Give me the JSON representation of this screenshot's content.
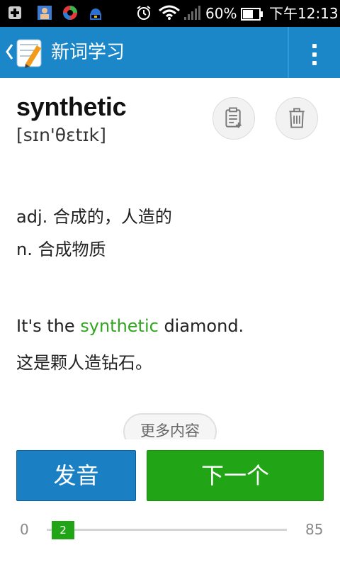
{
  "status_bar": {
    "battery_percent": "60%",
    "time": "下午12:13",
    "icons": [
      "add-icon",
      "contacts-app-icon",
      "colorful-app-icon",
      "android-download-icon",
      "alarm-icon",
      "wifi-icon",
      "signal-icon",
      "battery-icon"
    ]
  },
  "action_bar": {
    "title": "新词学习",
    "icons": [
      "back-chevron-icon",
      "app-logo-icon",
      "overflow-menu-icon"
    ]
  },
  "word": {
    "text": "synthetic",
    "phonetic": "[sɪn'θɛtɪk]"
  },
  "definitions": [
    "adj. 合成的，人造的",
    "n. 合成物质"
  ],
  "example": {
    "before": "It's the ",
    "highlight": "synthetic",
    "after": " diamond.",
    "translation": "这是颗人造钻石。"
  },
  "more_button": "更多内容",
  "buttons": {
    "speak": "发音",
    "next": "下一个"
  },
  "progress": {
    "min": "0",
    "max": "85",
    "current": "2",
    "value": 2
  },
  "colors": {
    "action_bar": "#1b87c9",
    "highlight": "#2fa61e",
    "speak_button": "#1b7fc4",
    "next_button": "#21a516"
  }
}
